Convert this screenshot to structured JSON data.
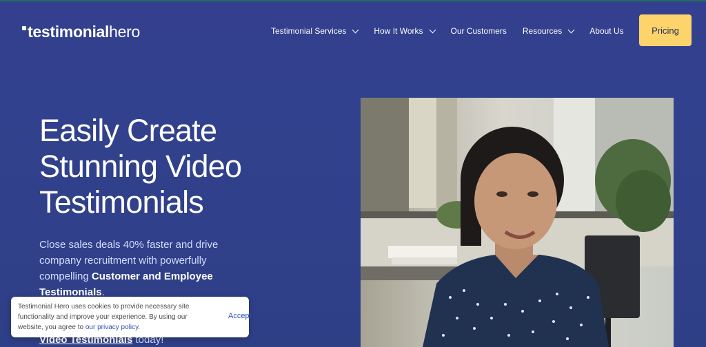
{
  "logo": {
    "bold": "testimonial",
    "light": "hero"
  },
  "nav": {
    "items": [
      {
        "label": "Testimonial Services",
        "has_dropdown": true
      },
      {
        "label": "How It Works",
        "has_dropdown": true
      },
      {
        "label": "Our Customers",
        "has_dropdown": false
      },
      {
        "label": "Resources",
        "has_dropdown": true
      },
      {
        "label": "About Us",
        "has_dropdown": false
      }
    ],
    "pricing_label": "Pricing"
  },
  "hero": {
    "headline": [
      "Easily Create",
      "Stunning Video",
      "Testimonials"
    ],
    "sub_part1": "Close sales deals 40% faster and drive company recruitment with powerfully compelling ",
    "sub_bold": "Customer and Employee Testimonials",
    "sub_part2": ".",
    "sub2_bold": "Video Testimonials",
    "sub2_rest": " today!"
  },
  "cookie": {
    "text": "Testimonial Hero uses cookies to provide necessary site functionality and improve your experience. By using our website, you agree to ",
    "link": "our privacy policy",
    "end": ".",
    "accept_label": "Accept"
  },
  "colors": {
    "accent": "#fcd46b",
    "background": "#34408f",
    "link": "#2d4fb3"
  }
}
